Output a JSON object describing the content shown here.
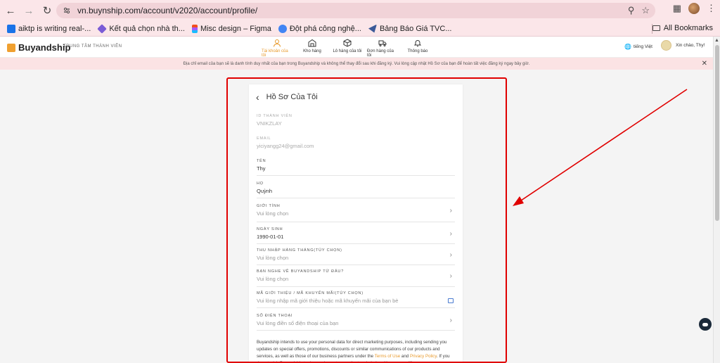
{
  "browser": {
    "url": "vn.buynship.com/account/v2020/account/profile/",
    "bookmarks": [
      {
        "label": "aiktp is writing real-...",
        "color": "#1a73e8"
      },
      {
        "label": "Kết quả chọn nhà th...",
        "color": "#7b5cd6"
      },
      {
        "label": "Misc design – Figma",
        "color": "#f24e1e"
      },
      {
        "label": "Đột phá công nghệ...",
        "color": "#4285f4"
      },
      {
        "label": "Bảng Báo Giá TVC...",
        "color": "#3b5998"
      }
    ],
    "all_bookmarks": "All Bookmarks"
  },
  "site": {
    "logo": "Buyandship",
    "member_center": "TRUNG TÂM THÀNH VIÊN",
    "nav": [
      {
        "label": "Tài khoản của tôi",
        "active": true
      },
      {
        "label": "Kho hàng",
        "active": false
      },
      {
        "label": "Lô hàng của tôi",
        "active": false
      },
      {
        "label": "Đơn hàng của tôi",
        "active": false
      },
      {
        "label": "Thông báo",
        "active": false
      }
    ],
    "language": "tiếng Việt",
    "greeting": "Xin chào, Thy!",
    "notice": "Địa chỉ email của bạn sẽ là danh tính duy nhất của bạn trong Buyandship và không thể thay đổi sau khi đăng ký. Vui lòng cập nhật Hồ Sơ của bạn để hoàn tất việc đăng ký ngay bây giờ."
  },
  "profile": {
    "title": "Hồ Sơ Của Tôi",
    "fields": [
      {
        "label": "ID THÀNH VIÊN",
        "value": "VNIKZLAY"
      },
      {
        "label": "EMAIL",
        "value": "yiciyangg24@gmail.com"
      },
      {
        "label": "TÊN",
        "value": "Thy"
      },
      {
        "label": "HỌ",
        "value": "Quỳnh"
      },
      {
        "label": "GIỚI TÍNH",
        "value": "Vui lòng chọn"
      },
      {
        "label": "NGÀY SINH",
        "value": "1990-01-01"
      },
      {
        "label": "THU NHẬP HÀNG THÁNG(TÙY CHỌN)",
        "value": "Vui lòng chọn"
      },
      {
        "label": "BẠN NGHE VỀ BUYANDSHIP TỪ ĐÂU?",
        "value": "Vui lòng chọn"
      },
      {
        "label": "MÃ GIỚI THIỆU / MÃ KHUYẾN MÃI(TÙY CHỌN)",
        "value": "Vui lòng nhập mã giới thiệu hoặc mã khuyến mãi của bạn bè"
      },
      {
        "label": "SỐ ĐIỆN THOẠI",
        "value": "Vui lòng điền số điện thoại của bạn"
      }
    ],
    "disclaimer_1": "Buyandship intends to use your personal data for direct marketing purposes, including sending you updates on special offers, promotions, discounts or similar communications of our products and services, as well as those of our business partners under the ",
    "terms": "Terms of Use",
    "and": " and ",
    "privacy": "Privacy Policy",
    "disclaimer_2": ". If you do not wish Buyandship to do so, please turn on the toggle below. You can modify your"
  },
  "colors": {
    "accent": "#e89a2c",
    "annotation": "#e00000"
  }
}
